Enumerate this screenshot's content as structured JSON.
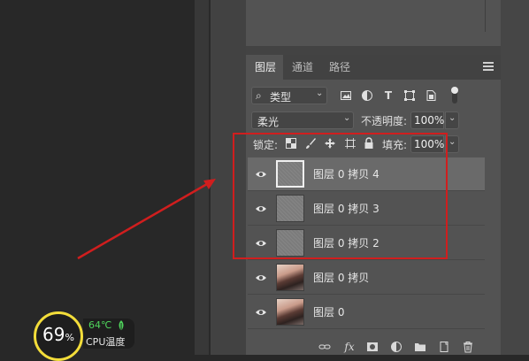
{
  "tabs": [
    "图层",
    "通道",
    "路径"
  ],
  "filter": {
    "label": "类型"
  },
  "blend": {
    "mode": "柔光",
    "opacity_label": "不透明度:",
    "opacity_value": "100%"
  },
  "lock": {
    "label": "锁定:",
    "fill_label": "填充:",
    "fill_value": "100%"
  },
  "layers": [
    {
      "name": "图层 0 拷贝 4",
      "selected": true
    },
    {
      "name": "图层 0 拷贝 3",
      "selected": false
    },
    {
      "name": "图层 0 拷贝 2",
      "selected": false
    },
    {
      "name": "图层 0 拷贝",
      "selected": false
    },
    {
      "name": "图层 0",
      "selected": false
    }
  ],
  "bottom_icons": [
    "link-icon",
    "fx-icon",
    "mask-icon",
    "adjustment-icon",
    "folder-icon",
    "new-layer-icon",
    "trash-icon"
  ],
  "cpu": {
    "percent": "69",
    "unit": "%",
    "temp": "64℃",
    "label": "CPU温度"
  },
  "colors": {
    "annotation": "#d01e1e",
    "cpu_ring": "#f3dd3a",
    "cpu_temp": "#4fd45c"
  }
}
